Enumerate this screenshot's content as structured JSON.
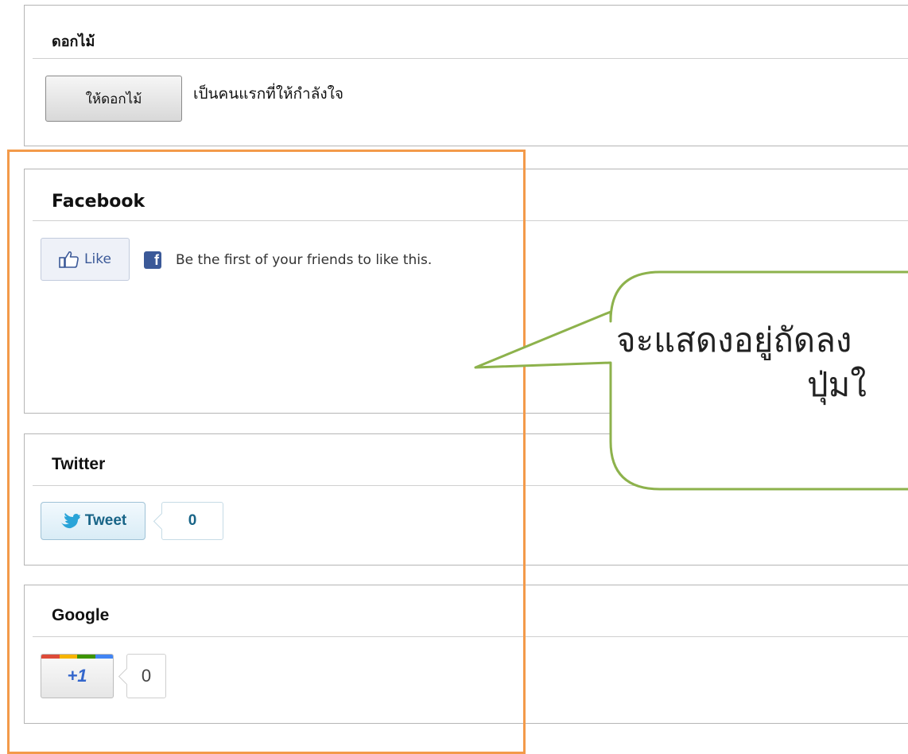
{
  "flower": {
    "title": "ดอกไม้",
    "button_label": "ให้ดอกไม้",
    "status_text": "เป็นคนแรกที่ให้กำลังใจ"
  },
  "facebook": {
    "title": "Facebook",
    "like_label": "Like",
    "logo_letter": "f",
    "friends_text": "Be the first of your friends to like this."
  },
  "twitter": {
    "title": "Twitter",
    "tweet_label": "Tweet",
    "count": "0"
  },
  "google": {
    "title": "Google",
    "plus_label": "+1",
    "count": "0",
    "bar_colors": [
      "#dd4b39",
      "#f6b400",
      "#3d9400",
      "#4285f4"
    ]
  },
  "callout": {
    "line1": "จะแสดงอยู่ถัดลง",
    "line2": "ปุ่มใ"
  },
  "colors": {
    "highlight": "#f39a4a",
    "callout_border": "#8db24c",
    "facebook_blue": "#3b5998",
    "twitter_blue": "#186487"
  }
}
